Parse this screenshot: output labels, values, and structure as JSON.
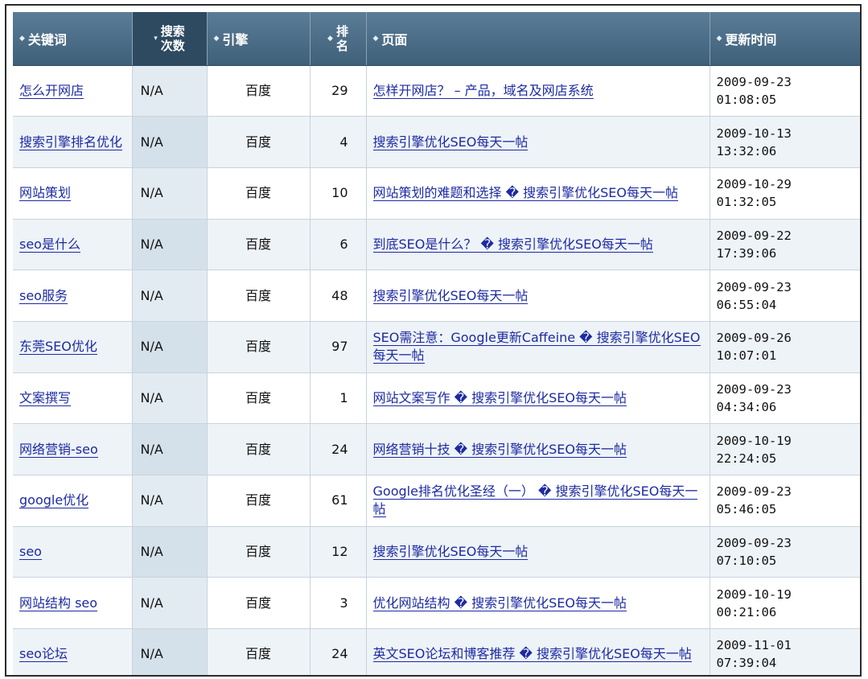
{
  "columns": [
    {
      "arrow": "◆",
      "label": "关键词"
    },
    {
      "arrow": "▾",
      "label_line1": "搜索",
      "label_line2": "次数"
    },
    {
      "arrow": "◆",
      "label": "引擎"
    },
    {
      "arrow": "◆",
      "label_line1": "排",
      "label_line2": "名"
    },
    {
      "arrow": "◆",
      "label": "页面"
    },
    {
      "arrow": "◆",
      "label": "更新时间"
    }
  ],
  "rows": [
    {
      "keyword": "怎么开网店",
      "count": "N/A",
      "engine": "百度",
      "rank": "29",
      "page": "怎样开网店？ – 产品，域名及网店系统",
      "date": "2009-09-23",
      "time": "01:08:05"
    },
    {
      "keyword": "搜索引擎排名优化",
      "count": "N/A",
      "engine": "百度",
      "rank": "4",
      "page": "搜索引擎优化SEO每天一帖",
      "date": "2009-10-13",
      "time": "13:32:06"
    },
    {
      "keyword": "网站策划",
      "count": "N/A",
      "engine": "百度",
      "rank": "10",
      "page": "网站策划的难题和选择 � 搜索引擎优化SEO每天一帖",
      "date": "2009-10-29",
      "time": "01:32:05"
    },
    {
      "keyword": "seo是什么",
      "count": "N/A",
      "engine": "百度",
      "rank": "6",
      "page": "到底SEO是什么？ � 搜索引擎优化SEO每天一帖",
      "date": "2009-09-22",
      "time": "17:39:06"
    },
    {
      "keyword": "seo服务",
      "count": "N/A",
      "engine": "百度",
      "rank": "48",
      "page": "搜索引擎优化SEO每天一帖",
      "date": "2009-09-23",
      "time": "06:55:04"
    },
    {
      "keyword": "东莞SEO优化",
      "count": "N/A",
      "engine": "百度",
      "rank": "97",
      "page": "SEO需注意：Google更新Caffeine � 搜索引擎优化SEO每天一帖",
      "date": "2009-09-26",
      "time": "10:07:01"
    },
    {
      "keyword": "文案撰写",
      "count": "N/A",
      "engine": "百度",
      "rank": "1",
      "page": "网站文案写作 � 搜索引擎优化SEO每天一帖",
      "date": "2009-09-23",
      "time": "04:34:06"
    },
    {
      "keyword": "网络营销-seo",
      "count": "N/A",
      "engine": "百度",
      "rank": "24",
      "page": "网络营销十技 � 搜索引擎优化SEO每天一帖",
      "date": "2009-10-19",
      "time": "22:24:05"
    },
    {
      "keyword": "google优化",
      "count": "N/A",
      "engine": "百度",
      "rank": "61",
      "page": "Google排名优化圣经（一） � 搜索引擎优化SEO每天一帖",
      "date": "2009-09-23",
      "time": "05:46:05"
    },
    {
      "keyword": "seo",
      "count": "N/A",
      "engine": "百度",
      "rank": "12",
      "page": "搜索引擎优化SEO每天一帖",
      "date": "2009-09-23",
      "time": "07:10:05"
    },
    {
      "keyword": "网站结构 seo",
      "count": "N/A",
      "engine": "百度",
      "rank": "3",
      "page": "优化网站结构 � 搜索引擎优化SEO每天一帖",
      "date": "2009-10-19",
      "time": "00:21:06"
    },
    {
      "keyword": "seo论坛",
      "count": "N/A",
      "engine": "百度",
      "rank": "24",
      "page": "英文SEO论坛和博客推荐 � 搜索引擎优化SEO每天一帖",
      "date": "2009-11-01",
      "time": "07:39:04"
    }
  ],
  "colors": {
    "header_bg": "#4a6a85",
    "header_sorted_bg": "#2e4a61",
    "link": "#1c2aa3",
    "row_alt": "#eef3f7"
  }
}
